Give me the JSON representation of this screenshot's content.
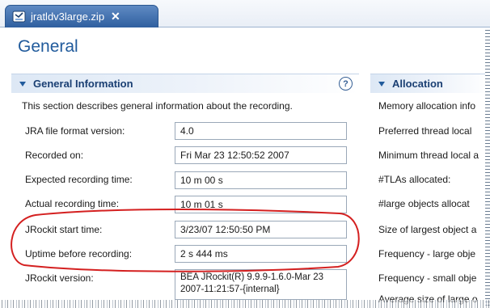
{
  "tab": {
    "title": "jratldv3large.zip",
    "close": "✕",
    "icon": "archive-file-icon"
  },
  "page": {
    "title": "General"
  },
  "general_section": {
    "title": "General Information",
    "help": "?",
    "description": "This section describes general information about the recording.",
    "fields": [
      {
        "label": "JRA file format version:",
        "value": "4.0"
      },
      {
        "label": "Recorded on:",
        "value": "Fri Mar 23 12:50:52 2007"
      },
      {
        "label": "Expected recording time:",
        "value": "10 m 00 s"
      },
      {
        "label": "Actual recording time:",
        "value": "10 m 01 s"
      },
      {
        "label": "JRockit start time:",
        "value": "3/23/07 12:50:50 PM"
      },
      {
        "label": "Uptime before recording:",
        "value": "2 s 444 ms"
      },
      {
        "label": "JRockit version:",
        "value": "BEA JRockit(R) 9.9.9-1.6.0-Mar 23 2007-11:21:57-{internal}"
      }
    ]
  },
  "allocation_section": {
    "title": "Allocation",
    "labels": [
      "Memory allocation info",
      "Preferred thread local",
      "Minimum thread local a",
      "#TLAs allocated:",
      "#large objects allocat",
      "Size of largest object a",
      "Frequency - large obje",
      "Frequency - small obje",
      "Average size of large o"
    ]
  },
  "annotation": {
    "color": "#d42020"
  },
  "colors": {
    "accent": "#215b9c",
    "tab": "#3f6ead",
    "section_bg": "#dde8f5"
  }
}
